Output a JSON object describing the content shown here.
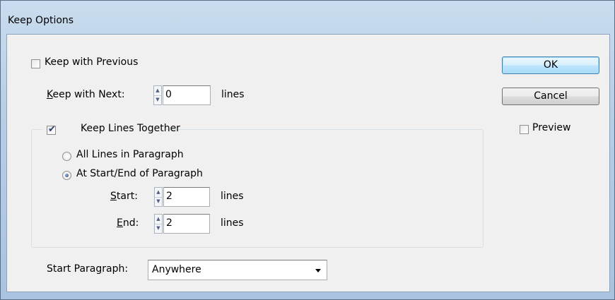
{
  "window": {
    "title": "Keep Options"
  },
  "keep_with_previous": {
    "label": "Keep with Previous",
    "checked": false
  },
  "keep_with_next": {
    "label_prefix": "",
    "label_underlined": "K",
    "label_rest": "eep with Next:",
    "value": "0",
    "unit": "lines"
  },
  "keep_lines_together": {
    "label": "Keep Lines Together",
    "checked": true
  },
  "radio_all_lines": {
    "label": "All Lines in Paragraph",
    "selected": false
  },
  "radio_start_end": {
    "label": "At Start/End of Paragraph",
    "selected": true
  },
  "start": {
    "label_underlined": "S",
    "label_rest": "tart:",
    "value": "2",
    "unit": "lines"
  },
  "end": {
    "label_underlined": "E",
    "label_rest": "nd:",
    "value": "2",
    "unit": "lines"
  },
  "start_paragraph": {
    "label_prefix": "Start Para",
    "label_underlined": "g",
    "label_rest": "raph:",
    "value": "Anywhere"
  },
  "buttons": {
    "ok": "OK",
    "cancel": "Cancel"
  },
  "preview": {
    "label": "Preview",
    "checked": false
  },
  "icons": {
    "check": "checkmark-icon",
    "spin_up": "spin-up-icon",
    "spin_down": "spin-down-icon",
    "dropdown": "chevron-down-icon"
  },
  "colors": {
    "accent": "#3c7fb1",
    "dialog_bg": "#f0f0f0",
    "frame": "#b9d1ea"
  }
}
